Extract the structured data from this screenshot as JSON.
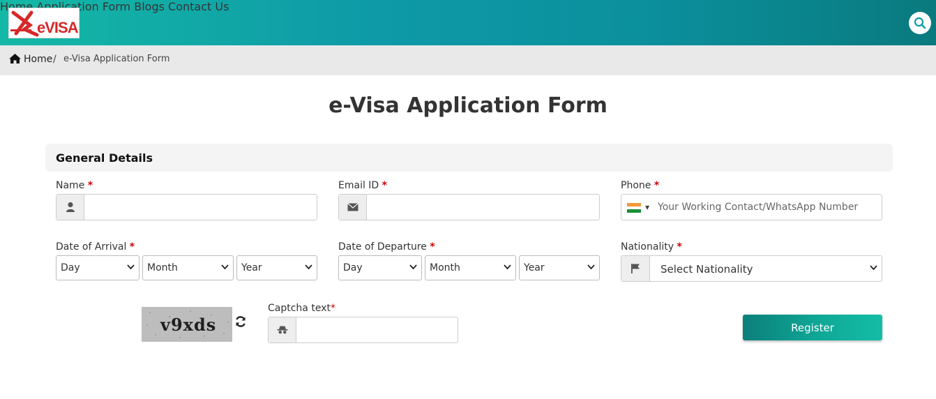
{
  "header": {
    "logo_text": "eVISA",
    "nav": [
      {
        "label": "Home"
      },
      {
        "label": "Application Form"
      },
      {
        "label": "Blogs"
      },
      {
        "label": "Contact Us"
      }
    ],
    "search_icon": "search-icon",
    "colors": {
      "gradient_start": "#14b8a6",
      "gradient_end": "#0a7a7e",
      "logo_red": "#d62828"
    }
  },
  "breadcrumb": {
    "home": "Home",
    "separator": "/",
    "current": "e-Visa Application Form"
  },
  "page": {
    "title": "e-Visa Application Form"
  },
  "section": {
    "title": "General Details"
  },
  "form": {
    "name": {
      "label": "Name",
      "required": "*",
      "value": ""
    },
    "email": {
      "label": "Email ID",
      "required": "*",
      "value": ""
    },
    "phone": {
      "label": "Phone",
      "required": "*",
      "placeholder": "Your Working Contact/WhatsApp Number",
      "value": ""
    },
    "arrival": {
      "label": "Date of Arrival",
      "required": "*",
      "day": "Day",
      "month": "Month",
      "year": "Year"
    },
    "departure": {
      "label": "Date of Departure",
      "required": "*",
      "day": "Day",
      "month": "Month",
      "year": "Year"
    },
    "nationality": {
      "label": "Nationality",
      "required": "*",
      "selected": "Select Nationality"
    },
    "captcha": {
      "image_text": "v9xds",
      "label": "Captcha text",
      "required": "*",
      "value": ""
    },
    "register_label": "Register"
  }
}
